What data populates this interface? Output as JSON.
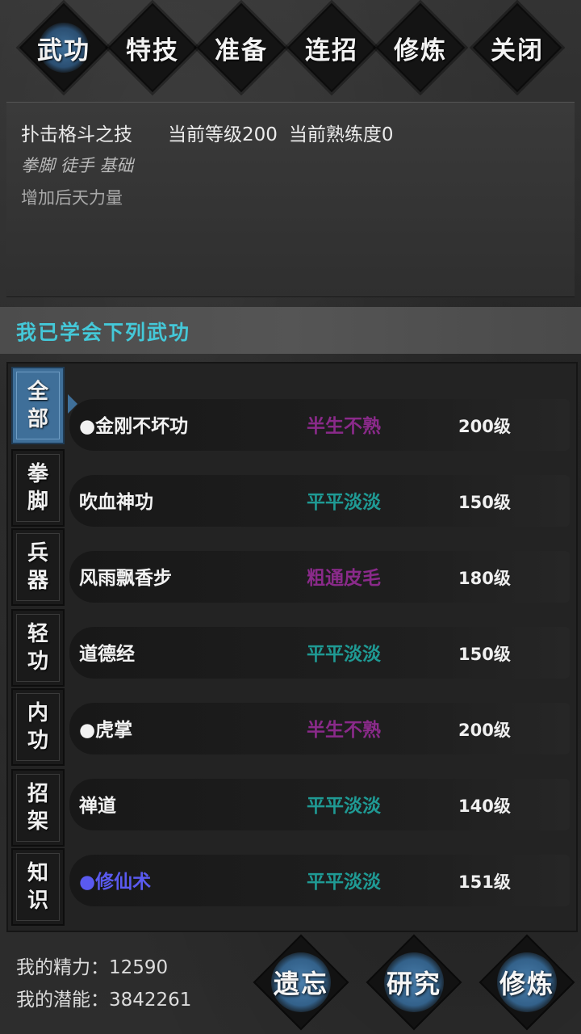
{
  "tabs": [
    {
      "label": "武功",
      "active": true
    },
    {
      "label": "特技",
      "active": false
    },
    {
      "label": "准备",
      "active": false
    },
    {
      "label": "连招",
      "active": false
    },
    {
      "label": "修炼",
      "active": false
    },
    {
      "label": "关闭",
      "active": false
    }
  ],
  "info": {
    "skill_name": "扑击格斗之技",
    "current_level": "当前等级200",
    "current_proficiency": "当前熟练度0",
    "tags": "拳脚 徒手 基础",
    "effect": "增加后天力量"
  },
  "learned_header": "我已学会下列武功",
  "categories": [
    {
      "label1": "全",
      "label2": "部",
      "active": true
    },
    {
      "label1": "拳",
      "label2": "脚",
      "active": false
    },
    {
      "label1": "兵",
      "label2": "器",
      "active": false
    },
    {
      "label1": "轻",
      "label2": "功",
      "active": false
    },
    {
      "label1": "内",
      "label2": "功",
      "active": false
    },
    {
      "label1": "招",
      "label2": "架",
      "active": false
    },
    {
      "label1": "知",
      "label2": "识",
      "active": false
    }
  ],
  "skills": [
    {
      "name": "●金刚不坏功",
      "grade": "半生不熟",
      "grade_color": "#8a2a8a",
      "level": "200级",
      "name_color": "#f2f2f2"
    },
    {
      "name": "吹血神功",
      "grade": "平平淡淡",
      "grade_color": "#1f9a94",
      "level": "150级",
      "name_color": "#f2f2f2"
    },
    {
      "name": "风雨飘香步",
      "grade": "粗通皮毛",
      "grade_color": "#8a2a8a",
      "level": "180级",
      "name_color": "#f2f2f2"
    },
    {
      "name": "道德经",
      "grade": "平平淡淡",
      "grade_color": "#1f9a94",
      "level": "150级",
      "name_color": "#f2f2f2"
    },
    {
      "name": "●虎掌",
      "grade": "半生不熟",
      "grade_color": "#8a2a8a",
      "level": "200级",
      "name_color": "#f2f2f2"
    },
    {
      "name": "禅道",
      "grade": "平平淡淡",
      "grade_color": "#1f9a94",
      "level": "140级",
      "name_color": "#f2f2f2"
    },
    {
      "name": "●修仙术",
      "grade": "平平淡淡",
      "grade_color": "#1f9a94",
      "level": "151级",
      "name_color": "#5a5af0"
    }
  ],
  "stats": {
    "energy": "我的精力：12590",
    "potential": "我的潜能：3842261"
  },
  "buttons": {
    "forget": "遗忘",
    "research": "研究",
    "practice": "修炼"
  }
}
